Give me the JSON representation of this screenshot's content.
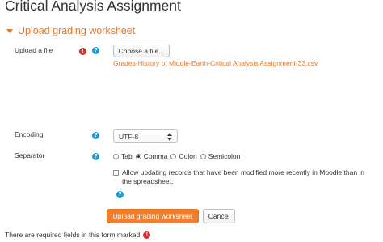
{
  "page": {
    "title": "Critical Analysis Assignment"
  },
  "section": {
    "title": "Upload grading worksheet",
    "expanded": true,
    "accent_color": "#e87624"
  },
  "upload": {
    "label": "Upload a file",
    "required_icon": "!",
    "help_icon": "?",
    "choose_button": "Choose a file...",
    "selected_file": "Grades-History of Middle-Earth-Critical Analysis Assignment-33.csv"
  },
  "encoding": {
    "label": "Encoding",
    "help_icon": "?",
    "selected": "UTF-8"
  },
  "separator": {
    "label": "Separator",
    "help_icon": "?",
    "options": [
      {
        "label": "Tab",
        "checked": false
      },
      {
        "label": "Comma",
        "checked": true
      },
      {
        "label": "Colon",
        "checked": false
      },
      {
        "label": "Semicolon",
        "checked": false
      }
    ]
  },
  "allow_updating": {
    "label": "Allow updating records that have been modified more recently in Moodle than in the spreadsheet.",
    "checked": false,
    "help_icon": "?"
  },
  "actions": {
    "submit": "Upload grading worksheet",
    "cancel": "Cancel",
    "primary_color": "#f07d2a"
  },
  "footer": {
    "required_note": "There are required fields in this form marked",
    "required_icon": "!",
    "period": "."
  }
}
